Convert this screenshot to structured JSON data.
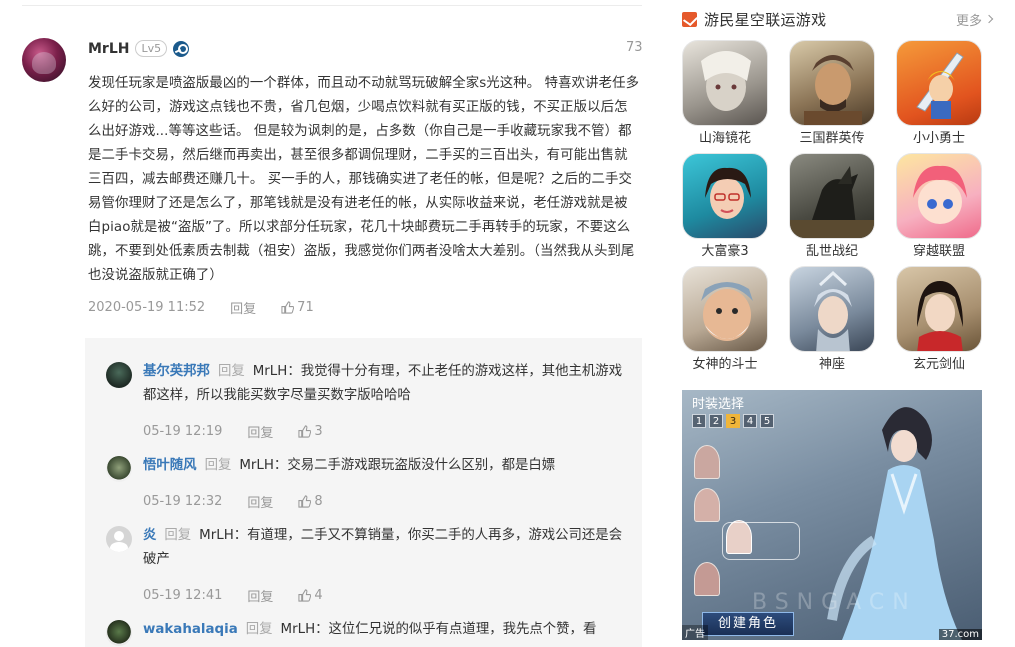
{
  "comment": {
    "user": "MrLH",
    "level": "Lv5",
    "floor": "73",
    "body": "发现任玩家是喷盗版最凶的一个群体，而且动不动就骂玩破解全家s光这种。 特喜欢讲老任多么好的公司，游戏这点钱也不贵，省几包烟，少喝点饮料就有买正版的钱，不买正版以后怎么出好游戏...等等这些话。 但是较为讽刺的是，占多数（你自己是一手收藏玩家我不管）都是二手卡交易，然后继而再卖出，甚至很多都调侃理财，二手买的三百出头，有可能出售就三百四，减去邮费还赚几十。 买一手的人，那钱确实进了老任的帐，但是呢？之后的二手交易管你理财了还是怎么了，那笔钱就是没有进老任的帐，从实际收益来说，老任游戏就是被白piao就是被“盗版”了。所以求部分任玩家，花几十块邮费玩二手再转手的玩家，不要这么跳，不要到处低素质去制裁（祖安）盗版，我感觉你们两者没啥太大差别。（当然我从头到尾也没说盗版就正确了）",
    "time": "2020-05-19 11:52",
    "reply_label": "回复",
    "likes": "71"
  },
  "replies": [
    {
      "name": "基尔英邦邦",
      "kw": "回复",
      "text": "MrLH：我觉得十分有理，不止老任的游戏这样，其他主机游戏都这样，所以我能买数字尽量买数字版哈哈哈",
      "time": "05-19 12:19",
      "reply_label": "回复",
      "likes": "3"
    },
    {
      "name": "悟叶随风",
      "kw": "回复",
      "text": "MrLH：交易二手游戏跟玩盗版没什么区别，都是白嫖",
      "time": "05-19 12:32",
      "reply_label": "回复",
      "likes": "8"
    },
    {
      "name": "炎",
      "kw": "回复",
      "text": "MrLH：有道理，二手又不算销量，你买二手的人再多，游戏公司还是会破产",
      "time": "05-19 12:41",
      "reply_label": "回复",
      "likes": "4"
    },
    {
      "name": "wakahalaqia",
      "kw": "回复",
      "text": "MrLH：这位仁兄说的似乎有点道理，我先点个赞，看"
    }
  ],
  "sidebar": {
    "title": "游民星空联运游戏",
    "more": "更多",
    "games": [
      {
        "name": "山海镜花"
      },
      {
        "name": "三国群英传"
      },
      {
        "name": "小小勇士"
      },
      {
        "name": "大富豪3"
      },
      {
        "name": "乱世战纪"
      },
      {
        "name": "穿越联盟"
      },
      {
        "name": "女神的斗士"
      },
      {
        "name": "神座"
      },
      {
        "name": "玄元剑仙"
      }
    ],
    "ad": {
      "title": "时装选择",
      "tabs": [
        "1",
        "2",
        "3",
        "4",
        "5"
      ],
      "button": "创建角色",
      "label": "广告",
      "source": "37.com",
      "watermark": "BSNGACN"
    }
  },
  "colors": {
    "link": "#3a79b8",
    "accent": "#e5592b",
    "reply_bg": "#f5f5f5"
  }
}
